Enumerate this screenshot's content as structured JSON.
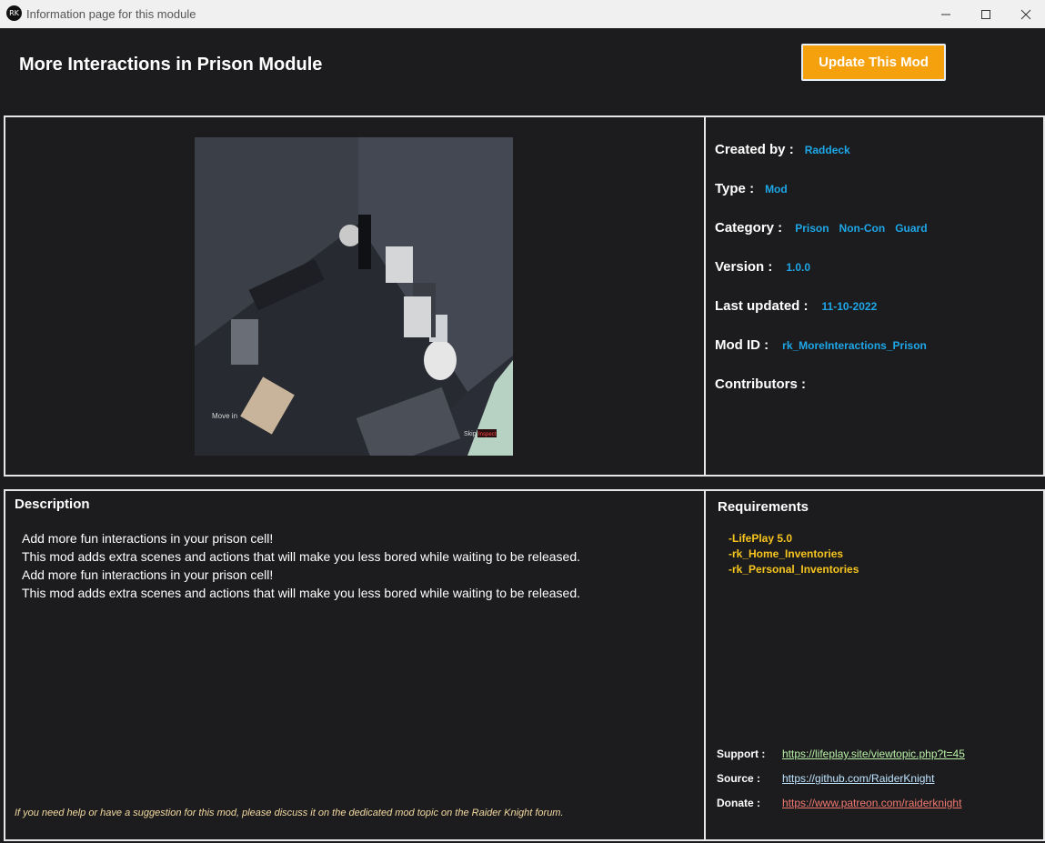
{
  "window": {
    "title": "Information page for this module",
    "icon_text": "RK"
  },
  "header": {
    "title": "More Interactions in Prison Module",
    "update_button": "Update This Mod"
  },
  "screenshot": {
    "overlay_left": "Move in",
    "overlay_right_prefix": "Skip",
    "overlay_right_badge": "Inspect"
  },
  "info": {
    "created_by_label": "Created by :",
    "created_by": "Raddeck",
    "type_label": "Type :",
    "type": "Mod",
    "category_label": "Category :",
    "categories": [
      "Prison",
      "Non-Con",
      "Guard"
    ],
    "version_label": "Version :",
    "version": "1.0.0",
    "last_updated_label": "Last updated :",
    "last_updated": "11-10-2022",
    "mod_id_label": "Mod ID :",
    "mod_id": "rk_MoreInteractions_Prison",
    "contributors_label": "Contributors :"
  },
  "description": {
    "title": "Description",
    "lines": [
      "Add more fun interactions in your prison cell!",
      "This mod adds extra scenes and actions that will make you less bored while waiting to be released.",
      "Add more fun interactions in your prison cell!",
      "This mod adds extra scenes and actions that will make you less bored while waiting to be released."
    ],
    "footnote": "If you need help or have a suggestion for this mod, please discuss it on the dedicated mod topic on the Raider Knight forum."
  },
  "requirements": {
    "title": "Requirements",
    "items": [
      "-LifePlay 5.0",
      "-rk_Home_Inventories",
      "-rk_Personal_Inventories"
    ]
  },
  "links": {
    "support_label": "Support :",
    "support_url": "https://lifeplay.site/viewtopic.php?t=45",
    "source_label": "Source :",
    "source_url": "https://github.com/RaiderKnight",
    "donate_label": "Donate :",
    "donate_url": "https://www.patreon.com/raiderknight"
  },
  "colors": {
    "background": "#1c1c1e",
    "accent_orange": "#f5a10e",
    "value_blue": "#1ea7e8",
    "requirement_yellow": "#f7c51e",
    "support_link": "#b8f0a6",
    "source_link": "#bfe4ff",
    "donate_link": "#f47a72"
  }
}
